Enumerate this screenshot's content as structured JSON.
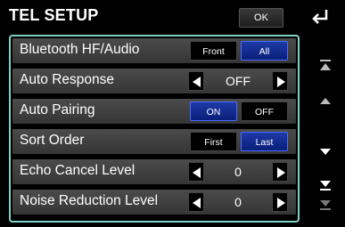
{
  "header": {
    "title": "TEL SETUP",
    "ok_label": "OK"
  },
  "rows": [
    {
      "label": "Bluetooth HF/Audio",
      "options": [
        "Front",
        "All"
      ],
      "selected": "All"
    },
    {
      "label": "Auto Response",
      "value": "OFF"
    },
    {
      "label": "Auto Pairing",
      "options": [
        "ON",
        "OFF"
      ],
      "selected": "ON"
    },
    {
      "label": "Sort Order",
      "options": [
        "First",
        "Last"
      ],
      "selected": "Last"
    },
    {
      "label": "Echo Cancel Level",
      "value": "0"
    },
    {
      "label": "Noise Reduction Level",
      "value": "0"
    }
  ],
  "icons": {
    "back": "back-arrow-icon",
    "scroll_top": "scroll-to-top-icon",
    "scroll_up": "scroll-up-icon",
    "scroll_down": "scroll-down-icon",
    "scroll_bottom": "scroll-to-bottom-icon"
  },
  "colors": {
    "panel_border": "#7fd3c6",
    "selected_button": "#1d3aa6",
    "row_background": "#444444"
  }
}
